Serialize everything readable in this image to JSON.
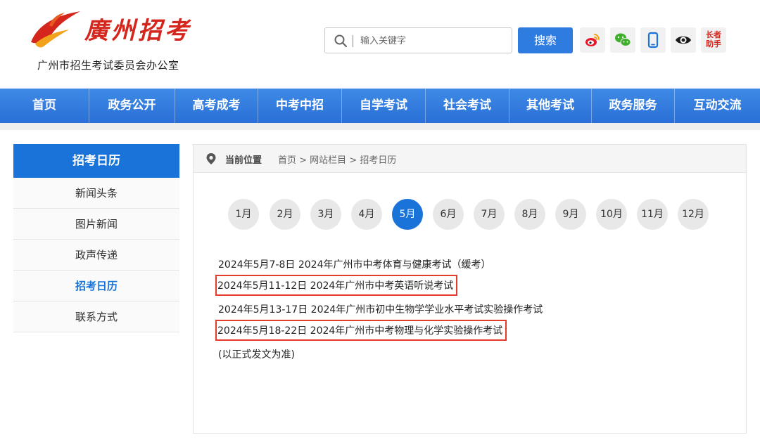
{
  "header": {
    "logo_title": "廣州招考",
    "logo_subtitle": "广州市招生考试委员会办公室",
    "search_placeholder": "输入关键字",
    "search_button": "搜索",
    "elder_mode_label": "长者助手",
    "brand_red": "#d4261c",
    "accent_blue": "#2f7ce0"
  },
  "nav": {
    "items": [
      "首页",
      "政务公开",
      "高考成考",
      "中考中招",
      "自学考试",
      "社会考试",
      "其他考试",
      "政务服务",
      "互动交流"
    ]
  },
  "sidebar": {
    "heading": "招考日历",
    "items": [
      {
        "label": "新闻头条",
        "active": false
      },
      {
        "label": "图片新闻",
        "active": false
      },
      {
        "label": "政声传递",
        "active": false
      },
      {
        "label": "招考日历",
        "active": true
      },
      {
        "label": "联系方式",
        "active": false
      }
    ]
  },
  "breadcrumb": {
    "label": "当前位置",
    "path": "首页 > 网站栏目 > 招考日历"
  },
  "months": {
    "items": [
      "1月",
      "2月",
      "3月",
      "4月",
      "5月",
      "6月",
      "7月",
      "8月",
      "9月",
      "10月",
      "11月",
      "12月"
    ],
    "selected": "5月"
  },
  "events": [
    {
      "text": "2024年5月7-8日 2024年广州市中考体育与健康考试（缓考）",
      "highlighted": false
    },
    {
      "text": "2024年5月11-12日 2024年广州市中考英语听说考试",
      "highlighted": true
    },
    {
      "text": "2024年5月13-17日 2024年广州市初中生物学学业水平考试实验操作考试",
      "highlighted": false
    },
    {
      "text": "2024年5月18-22日 2024年广州市中考物理与化学实验操作考试",
      "highlighted": true
    }
  ],
  "note": "(以正式发文为准)"
}
